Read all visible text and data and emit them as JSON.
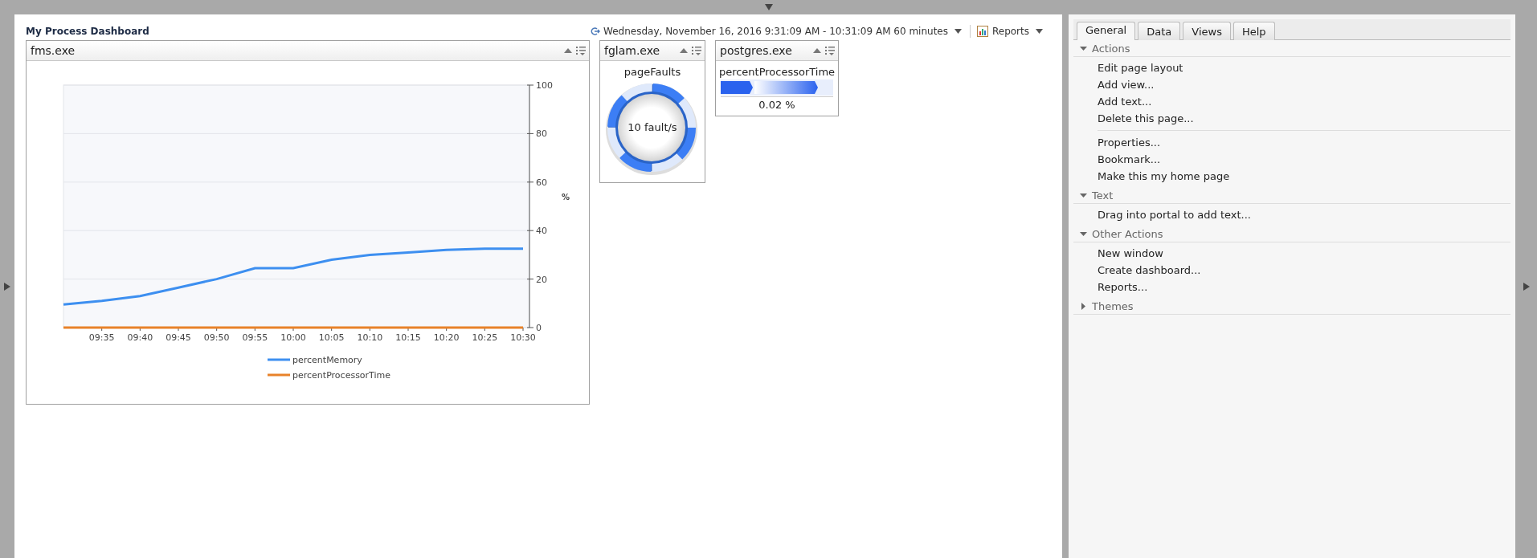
{
  "dashboard": {
    "title": "My Process Dashboard",
    "time_range": "Wednesday, November 16, 2016 9:31:09 AM - 10:31:09 AM 60 minutes",
    "reports": "Reports"
  },
  "views": [
    {
      "kind": "chart",
      "title": "fms.exe",
      "chart_data": {
        "type": "line",
        "ylabel": "%",
        "categories": [
          null,
          "09:35",
          "09:40",
          "09:45",
          "09:50",
          "09:55",
          "10:00",
          "10:05",
          "10:10",
          "10:15",
          "10:20",
          "10:25",
          "10:30"
        ],
        "ylim": [
          0,
          100
        ],
        "grid": true,
        "legend": true,
        "yticks": [
          0,
          20,
          40,
          60,
          80,
          100
        ],
        "series": [
          {
            "name": "percentMemory",
            "color": "#3d8ff0",
            "values": [
              9.5,
              11,
              13,
              16.5,
              20,
              24.5,
              24.5,
              28,
              30,
              31,
              32,
              32.5,
              32.5
            ]
          },
          {
            "name": "percentProcessorTime",
            "color": "#e8822a",
            "values": [
              0,
              0,
              0,
              0,
              0,
              0,
              0,
              0,
              0,
              0,
              0,
              0,
              0
            ]
          }
        ]
      }
    },
    {
      "kind": "gauge",
      "title": "fglam.exe",
      "metric": "pageFaults",
      "reading": "10 fault/s"
    },
    {
      "kind": "bar",
      "title": "postgres.exe",
      "metric": "percentProcessorTime",
      "reading": "0.02 %"
    }
  ],
  "sidebar": {
    "tabs": [
      {
        "label": "General",
        "selected": true
      },
      {
        "label": "Data",
        "selected": false
      },
      {
        "label": "Views",
        "selected": false
      },
      {
        "label": "Help",
        "selected": false
      }
    ],
    "sections": [
      {
        "title": "Actions",
        "expanded": true,
        "groups": [
          [
            "Edit page layout",
            "Add view...",
            "Add text...",
            "Delete this page..."
          ],
          [
            "Properties...",
            "Bookmark...",
            "Make this my home page"
          ]
        ]
      },
      {
        "title": "Text",
        "expanded": true,
        "groups": [
          [
            "Drag into portal to add text..."
          ]
        ]
      },
      {
        "title": "Other Actions",
        "expanded": true,
        "groups": [
          [
            "New window",
            "Create dashboard...",
            "Reports..."
          ]
        ]
      },
      {
        "title": "Themes",
        "expanded": false
      }
    ]
  }
}
